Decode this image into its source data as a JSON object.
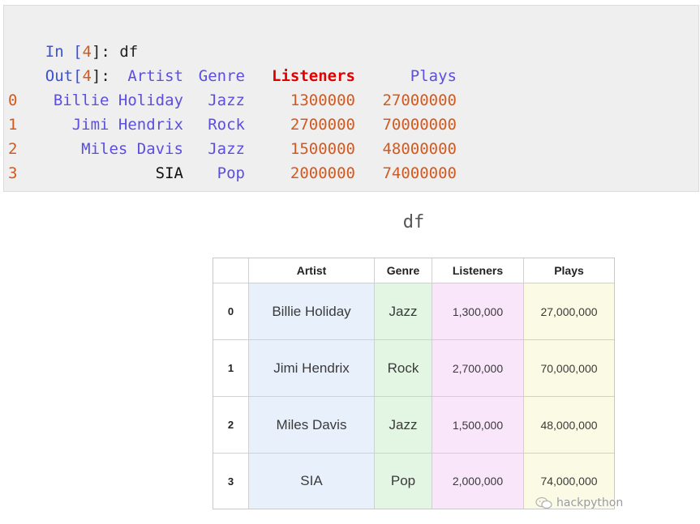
{
  "cell": {
    "in_prompt": "In [",
    "in_num": "4",
    "in_close": "]: ",
    "code": "df",
    "out_prompt": "Out[",
    "out_num": "4",
    "out_close": "]:"
  },
  "df_output": {
    "headers": {
      "artist": "Artist",
      "genre": "Genre",
      "listeners": "Listeners",
      "plays": "Plays"
    },
    "rows": [
      {
        "index": "0",
        "artist": "Billie Holiday",
        "genre": "Jazz",
        "listeners": "1300000",
        "plays": "27000000"
      },
      {
        "index": "1",
        "artist": "Jimi Hendrix",
        "genre": "Rock",
        "listeners": "2700000",
        "plays": "70000000"
      },
      {
        "index": "2",
        "artist": "Miles Davis",
        "genre": "Jazz",
        "listeners": "1500000",
        "plays": "48000000"
      },
      {
        "index": "3",
        "artist": "SIA",
        "genre": "Pop",
        "listeners": "2000000",
        "plays": "74000000"
      }
    ]
  },
  "diagram": {
    "title": "df",
    "headers": {
      "artist": "Artist",
      "genre": "Genre",
      "listeners": "Listeners",
      "plays": "Plays"
    },
    "rows": [
      {
        "index": "0",
        "artist": "Billie Holiday",
        "genre": "Jazz",
        "listeners": "1,300,000",
        "plays": "27,000,000"
      },
      {
        "index": "1",
        "artist": "Jimi Hendrix",
        "genre": "Rock",
        "listeners": "2,700,000",
        "plays": "70,000,000"
      },
      {
        "index": "2",
        "artist": "Miles Davis",
        "genre": "Jazz",
        "listeners": "1,500,000",
        "plays": "48,000,000"
      },
      {
        "index": "3",
        "artist": "SIA",
        "genre": "Pop",
        "listeners": "2,000,000",
        "plays": "74,000,000"
      }
    ],
    "colors": {
      "artist": "#e8f1fb",
      "genre": "#e3f6e3",
      "listeners": "#fae6fa",
      "plays": "#fbfbe5"
    }
  },
  "watermark": {
    "text": "hackpython",
    "icon": "wechat-icon"
  }
}
